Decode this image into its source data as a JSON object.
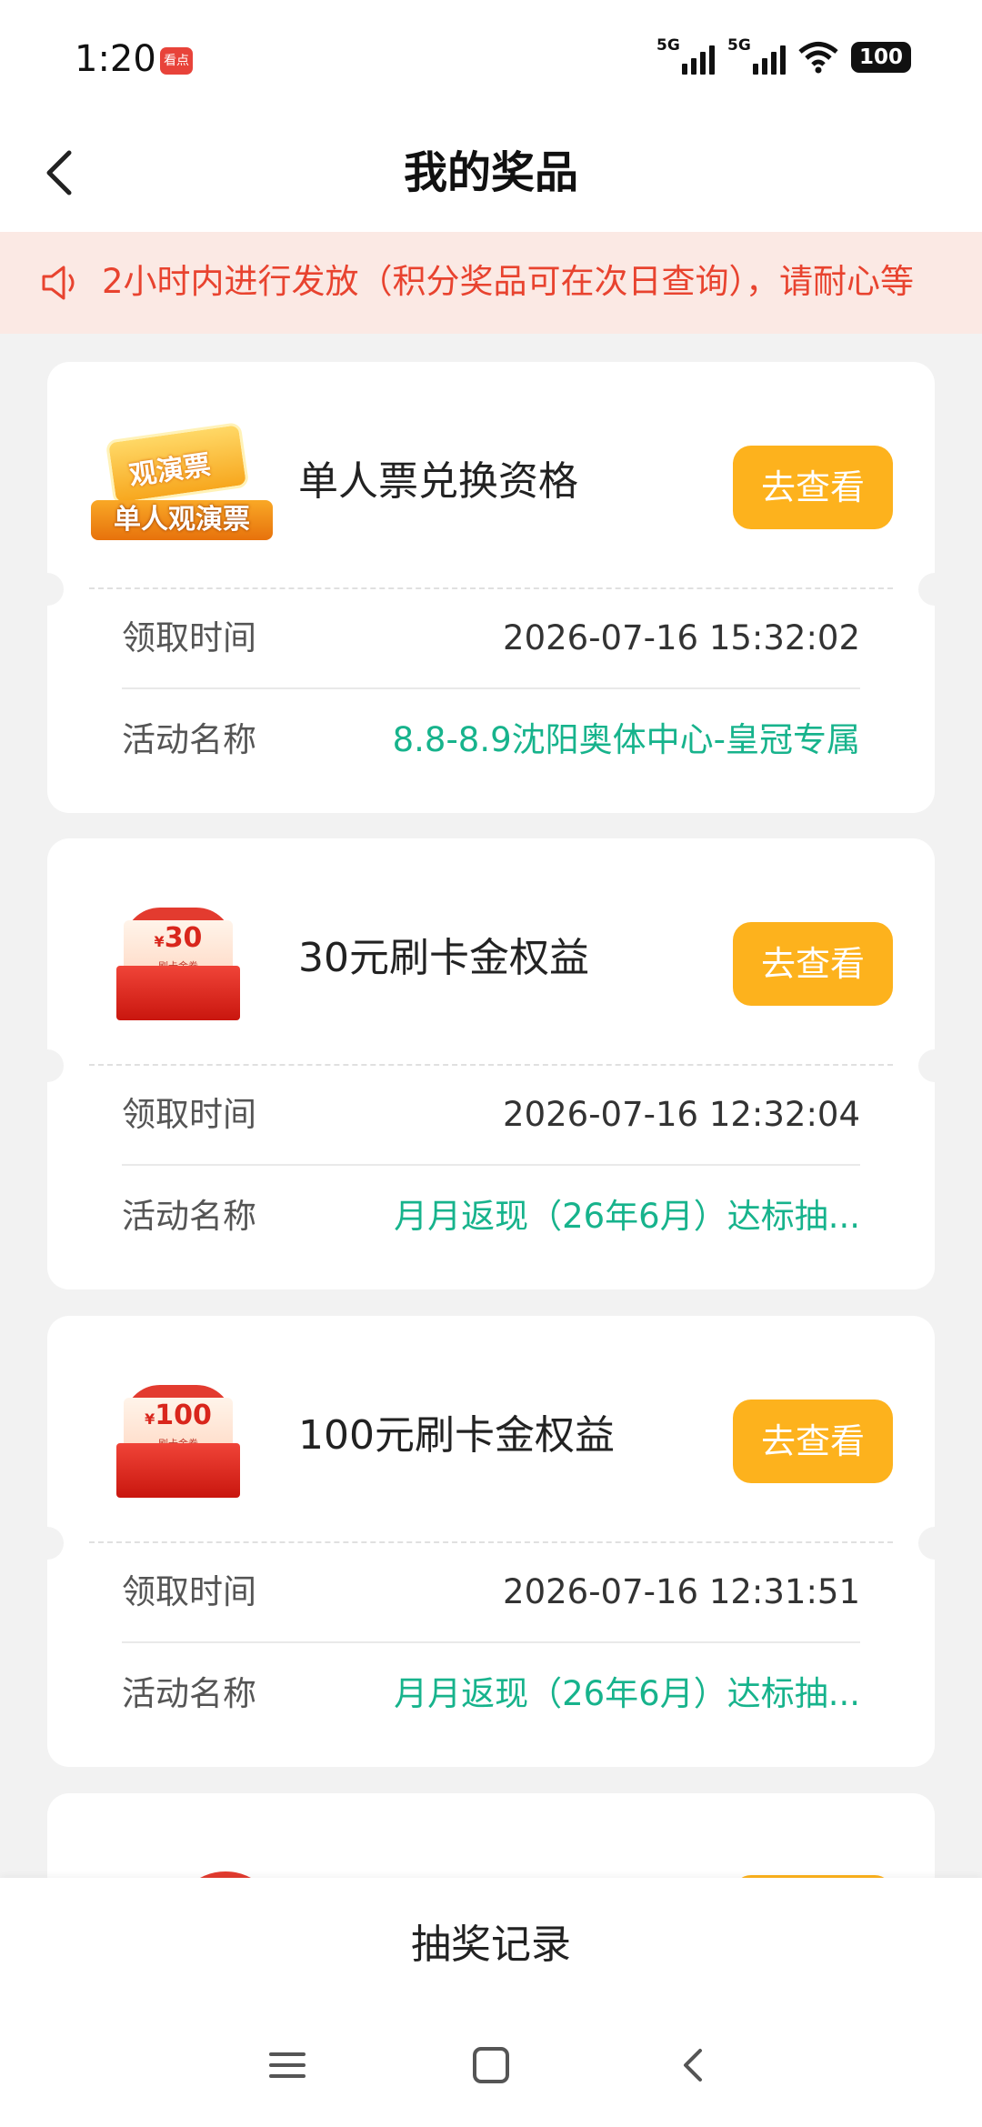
{
  "status_bar": {
    "time": "1:20",
    "app_badge": "看点",
    "signal1_label": "5G",
    "signal2_label": "5G",
    "battery": "100"
  },
  "header": {
    "title": "我的奖品"
  },
  "notice": {
    "text": "2小时内进行发放（积分奖品可在次日查询），请耐心等"
  },
  "prizes": [
    {
      "name": "单人票兑换资格",
      "image_text_top": "观演票",
      "image_text_band": "单人观演票",
      "button": "去查看",
      "time_label": "领取时间",
      "time": "2026-07-16 15:32:02",
      "activity_label": "活动名称",
      "activity": "8.8-8.9沈阳奥体中心-皇冠专属"
    },
    {
      "name": "30元刷卡金权益",
      "image_amount": "30",
      "image_currency": "¥",
      "image_sub": "— 刷卡金券 —",
      "button": "去查看",
      "time_label": "领取时间",
      "time": "2026-07-16 12:32:04",
      "activity_label": "活动名称",
      "activity": "月月返现（26年6月）达标抽..."
    },
    {
      "name": "100元刷卡金权益",
      "image_amount": "100",
      "image_currency": "¥",
      "image_sub": "— 刷卡金券 —",
      "button": "去查看",
      "time_label": "领取时间",
      "time": "2026-07-16 12:31:51",
      "activity_label": "活动名称",
      "activity": "月月返现（26年6月）达标抽..."
    }
  ],
  "bottom": {
    "lottery_record": "抽奖记录"
  },
  "colors": {
    "accent_button": "#fdb21d",
    "notice_text": "#e8432f",
    "activity_text": "#17b38c"
  }
}
